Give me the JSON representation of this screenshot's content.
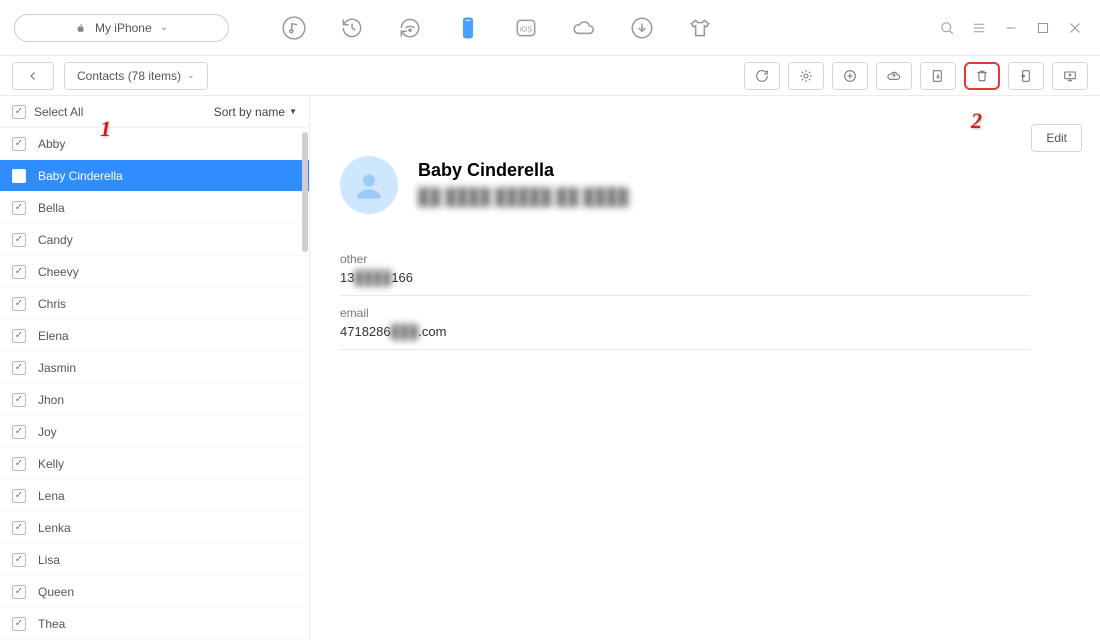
{
  "device": {
    "label": "My iPhone"
  },
  "breadcrumb": {
    "label": "Contacts (78 items)"
  },
  "sidehead": {
    "selectall": "Select All",
    "sort": "Sort by name"
  },
  "contacts": {
    "c0": "Abby",
    "c1": "Baby Cinderella",
    "c2": "Bella",
    "c3": "Candy",
    "c4": "Cheevy",
    "c5": "Chris",
    "c6": "Elena",
    "c7": "Jasmin",
    "c8": "Jhon",
    "c9": "Joy",
    "c10": "Kelly",
    "c11": "Lena",
    "c12": "Lenka",
    "c13": "Lisa",
    "c14": "Queen",
    "c15": "Thea"
  },
  "detail": {
    "name": "Baby Cinderella",
    "subtitle": "██ ████ █████ ██ ████",
    "phone_label": "other",
    "phone_value_a": "13",
    "phone_value_b": "████",
    "phone_value_c": "166",
    "email_label": "email",
    "email_value_a": "4718286",
    "email_value_b": "███",
    "email_value_c": ".com",
    "edit": "Edit"
  },
  "callouts": {
    "one": "1",
    "two": "2"
  }
}
